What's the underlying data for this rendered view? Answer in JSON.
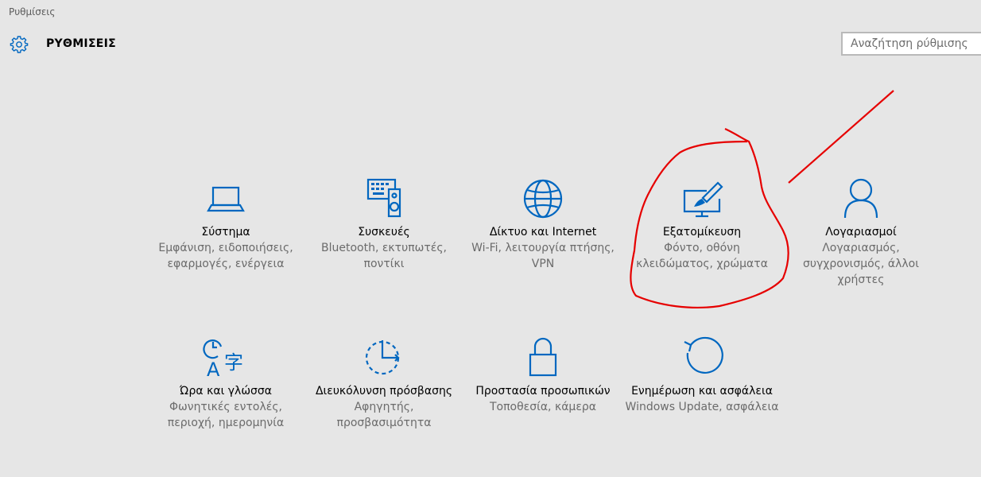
{
  "window": {
    "title": "Ρυθμίσεις"
  },
  "header": {
    "title": "ΡΥΘΜΙΣΕΙΣ",
    "search_placeholder": "Αναζήτηση ρύθμισης"
  },
  "colors": {
    "accent": "#0067c0",
    "annotation": "#e60000",
    "background": "#e6e6e6"
  },
  "categories": [
    {
      "icon": "laptop-icon",
      "name": "Σύστημα",
      "desc": "Εμφάνιση, ειδοποιήσεις, εφαρμογές, ενέργεια"
    },
    {
      "icon": "keyboard-speaker-icon",
      "name": "Συσκευές",
      "desc": "Bluetooth, εκτυπωτές, ποντίκι"
    },
    {
      "icon": "globe-icon",
      "name": "Δίκτυο και Internet",
      "desc": "Wi-Fi, λειτουργία πτήσης, VPN"
    },
    {
      "icon": "paintbrush-monitor-icon",
      "name": "Εξατομίκευση",
      "desc": "Φόντο, οθόνη κλειδώματος, χρώματα"
    },
    {
      "icon": "person-icon",
      "name": "Λογαριασμοί",
      "desc": "Λογαριασμός, συγχρονισμός, άλλοι χρήστες"
    },
    {
      "icon": "time-language-icon",
      "name": "Ώρα και γλώσσα",
      "desc": "Φωνητικές εντολές, περιοχή, ημερομηνία"
    },
    {
      "icon": "ease-of-access-icon",
      "name": "Διευκόλυνση πρόσβασης",
      "desc": "Αφηγητής, προσβασιμότητα"
    },
    {
      "icon": "lock-icon",
      "name": "Προστασία προσωπικών",
      "desc": "Τοποθεσία, κάμερα"
    },
    {
      "icon": "update-icon",
      "name": "Ενημέρωση και ασφάλεια",
      "desc": "Windows Update, ασφάλεια"
    }
  ]
}
